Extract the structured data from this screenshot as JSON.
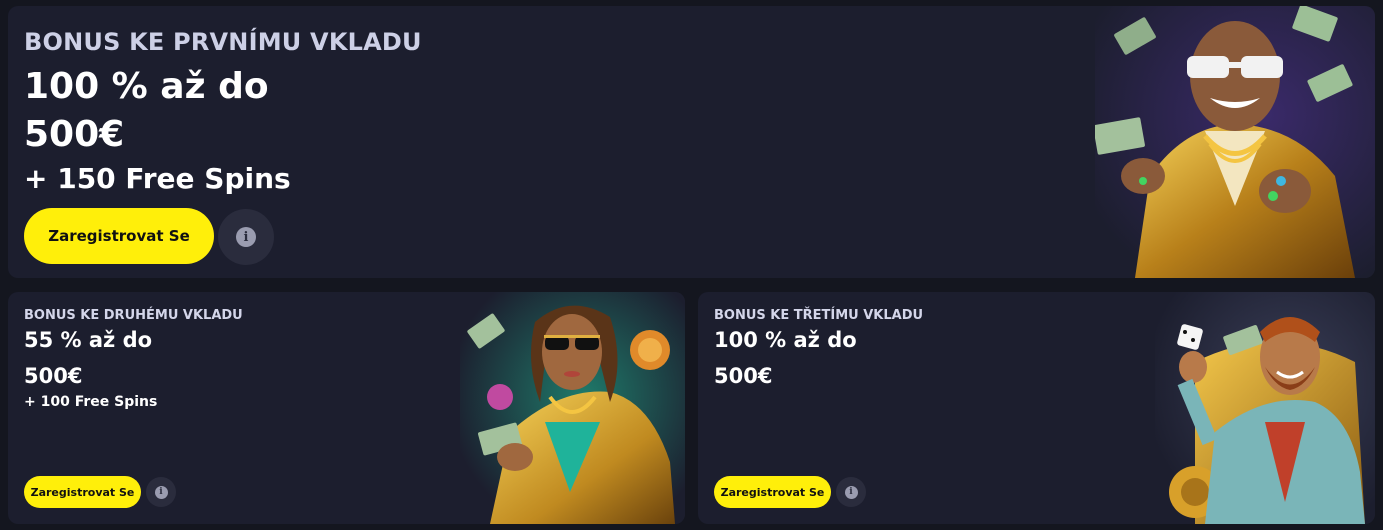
{
  "promo_main": {
    "eyebrow": "BONUS KE PRVNÍMU VKLADU",
    "line1": "100 % až do",
    "line2": "500€",
    "line3": "+ 150 Free Spins",
    "cta_label": "Zaregistrovat Se",
    "info_glyph": "i"
  },
  "promo_second": {
    "eyebrow": "BONUS KE DRUHÉMU VKLADU",
    "line1": "55 % až do",
    "line2": "500€",
    "line3": "+ 100 Free Spins",
    "cta_label": "Zaregistrovat Se",
    "info_glyph": "i"
  },
  "promo_third": {
    "eyebrow": "BONUS KE TŘETÍMU VKLADU",
    "line1": "100 % až do",
    "line2": "500€",
    "cta_label": "Zaregistrovat Se",
    "info_glyph": "i"
  },
  "colors": {
    "page_bg": "#14161f",
    "card_bg": "#1c1e2e",
    "cta_yellow": "#ffef0a",
    "info_bg": "#2a2c3d"
  },
  "icons": {
    "info": "info-icon",
    "art_main": "rich-man-character-illustration",
    "art_second": "gold-jacket-woman-illustration",
    "art_third": "dice-man-on-throne-illustration"
  }
}
